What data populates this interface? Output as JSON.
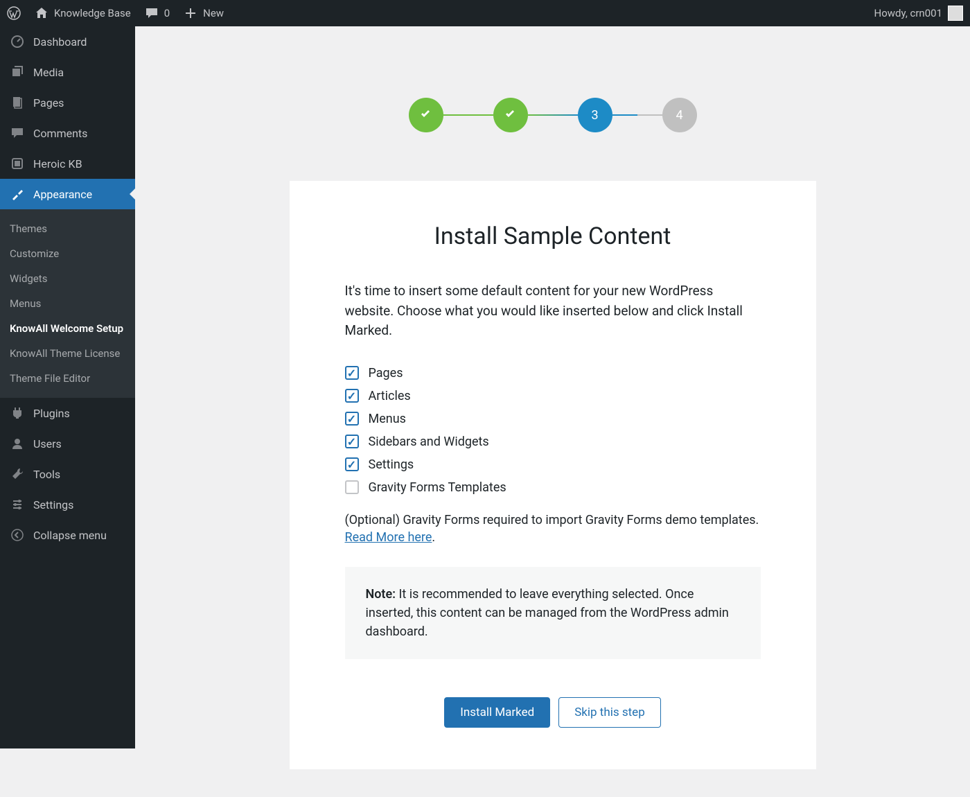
{
  "topbar": {
    "site_name": "Knowledge Base",
    "comments_count": "0",
    "new_label": "New",
    "howdy": "Howdy, crn001"
  },
  "sidebar": {
    "items": [
      {
        "label": "Dashboard",
        "name": "dashboard"
      },
      {
        "label": "Media",
        "name": "media"
      },
      {
        "label": "Pages",
        "name": "pages"
      },
      {
        "label": "Comments",
        "name": "comments"
      },
      {
        "label": "Heroic KB",
        "name": "heroic-kb"
      },
      {
        "label": "Appearance",
        "name": "appearance"
      },
      {
        "label": "Plugins",
        "name": "plugins"
      },
      {
        "label": "Users",
        "name": "users"
      },
      {
        "label": "Tools",
        "name": "tools"
      },
      {
        "label": "Settings",
        "name": "settings"
      }
    ],
    "submenu": [
      {
        "label": "Themes"
      },
      {
        "label": "Customize"
      },
      {
        "label": "Widgets"
      },
      {
        "label": "Menus"
      },
      {
        "label": "KnowAll Welcome Setup"
      },
      {
        "label": "KnowAll Theme License"
      },
      {
        "label": "Theme File Editor"
      }
    ],
    "collapse": "Collapse menu"
  },
  "stepper": {
    "step3": "3",
    "step4": "4"
  },
  "content": {
    "heading": "Install Sample Content",
    "intro": "It's time to insert some default content for your new WordPress website. Choose what you would like inserted below and click Install Marked.",
    "items": [
      {
        "label": "Pages",
        "checked": true
      },
      {
        "label": "Articles",
        "checked": true
      },
      {
        "label": "Menus",
        "checked": true
      },
      {
        "label": "Sidebars and Widgets",
        "checked": true
      },
      {
        "label": "Settings",
        "checked": true
      },
      {
        "label": "Gravity Forms Templates",
        "checked": false
      }
    ],
    "optional_prefix": "(Optional) Gravity Forms required to import Gravity Forms demo templates. ",
    "optional_link": "Read More here",
    "optional_suffix": ".",
    "note_label": "Note:",
    "note_text": " It is recommended to leave everything selected. Once inserted, this content can be managed from the WordPress admin dashboard.",
    "btn_primary": "Install Marked",
    "btn_secondary": "Skip this step"
  }
}
